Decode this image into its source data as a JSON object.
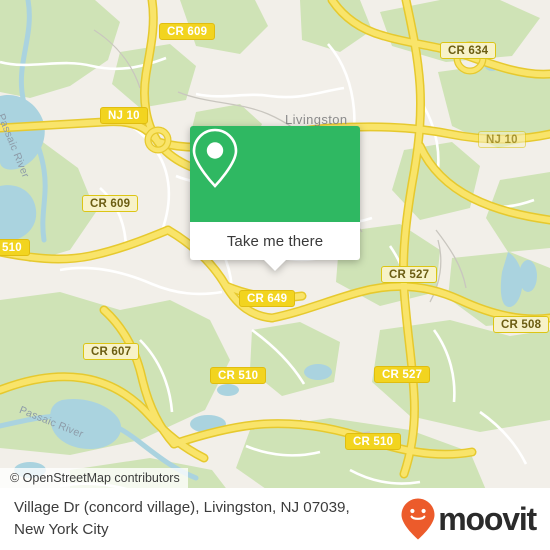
{
  "map": {
    "provider_name": "OpenStreetMap",
    "attribution": "© OpenStreetMap contributors",
    "place_labels": [
      {
        "name": "Livingston",
        "text": "Livingston"
      }
    ],
    "water_labels": [
      {
        "text": "Passaic River"
      },
      {
        "text": "Passaic River"
      }
    ],
    "road_shields": [
      {
        "label": "CR 609",
        "style": "filled"
      },
      {
        "label": "CR 634",
        "style": "outline"
      },
      {
        "label": "NJ 10",
        "style": "filled"
      },
      {
        "label": "NJ 10",
        "style": "outline"
      },
      {
        "label": "CR 609",
        "style": "outline"
      },
      {
        "label": "510",
        "style": "filled"
      },
      {
        "label": "CR 527",
        "style": "outline"
      },
      {
        "label": "CR 649",
        "style": "filled"
      },
      {
        "label": "CR 508",
        "style": "outline"
      },
      {
        "label": "CR 607",
        "style": "outline"
      },
      {
        "label": "CR 510",
        "style": "filled"
      },
      {
        "label": "CR 527",
        "style": "filled"
      },
      {
        "label": "CR 510",
        "style": "filled"
      }
    ],
    "colors": {
      "land": "#f2efe9",
      "green_area": "#cde3b5",
      "water": "#aad3df",
      "major_road": "#f7dc5c",
      "minor_road": "#ffffff",
      "road_casing": "#e8cf3f"
    }
  },
  "popup": {
    "icon": "map-pin-icon",
    "button_label": "Take me there",
    "accent_color": "#2fb862"
  },
  "footer": {
    "address_line1": "Village Dr (concord village), Livingston, NJ 07039,",
    "address_line2": "New York City",
    "brand_name": "moovit",
    "brand_color": "#ec5b2b"
  }
}
